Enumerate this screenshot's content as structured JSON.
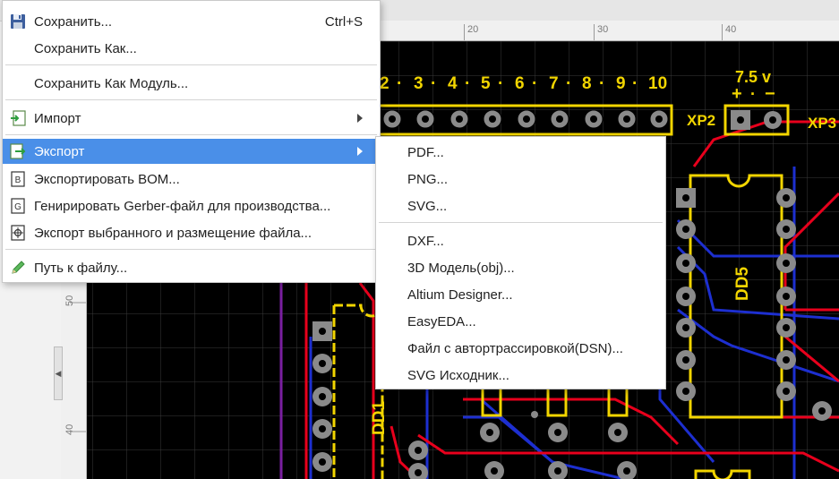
{
  "ruler_top": {
    "labels": [
      "20",
      "30",
      "40"
    ]
  },
  "ruler_left": {
    "labels": [
      "50",
      "40"
    ]
  },
  "board": {
    "header_numbers": [
      "2",
      "3",
      "4",
      "5",
      "6",
      "7",
      "8",
      "9",
      "10"
    ],
    "xp2_voltage": "7.5 v",
    "xp2_plus": "+",
    "xp2_minus": "−",
    "xp2_label": "XP2",
    "xp3_label": "XP3",
    "dd5_label": "DD5",
    "dd1_label": "DD1"
  },
  "main_menu": {
    "save": {
      "label": "Сохранить...",
      "shortcut": "Ctrl+S"
    },
    "save_as": {
      "label": "Сохранить Как..."
    },
    "save_as_module": {
      "label": "Сохранить Как Модуль..."
    },
    "import": {
      "label": "Импорт"
    },
    "export": {
      "label": "Экспорт"
    },
    "export_bom": {
      "label": "Экспортировать BOM..."
    },
    "gerber": {
      "label": "Генирировать Gerber-файл для производства..."
    },
    "export_selected": {
      "label": "Экспорт выбранного и размещение файла..."
    },
    "file_path": {
      "label": "Путь к файлу..."
    }
  },
  "export_submenu": {
    "items": [
      "PDF...",
      "PNG...",
      "SVG...",
      "DXF...",
      "3D Модель(obj)...",
      "Altium Designer...",
      "EasyEDA...",
      "Файл с автортрассировкой(DSN)...",
      "SVG Исходник..."
    ]
  },
  "colors": {
    "highlight": "#4a8fe8",
    "board": "#000000",
    "trace_red": "#e8001c",
    "trace_blue": "#1d2fd0",
    "silk_yellow": "#f2d500",
    "pad_gray": "#8a8a8a",
    "purple_edge": "#7a1fa0"
  }
}
